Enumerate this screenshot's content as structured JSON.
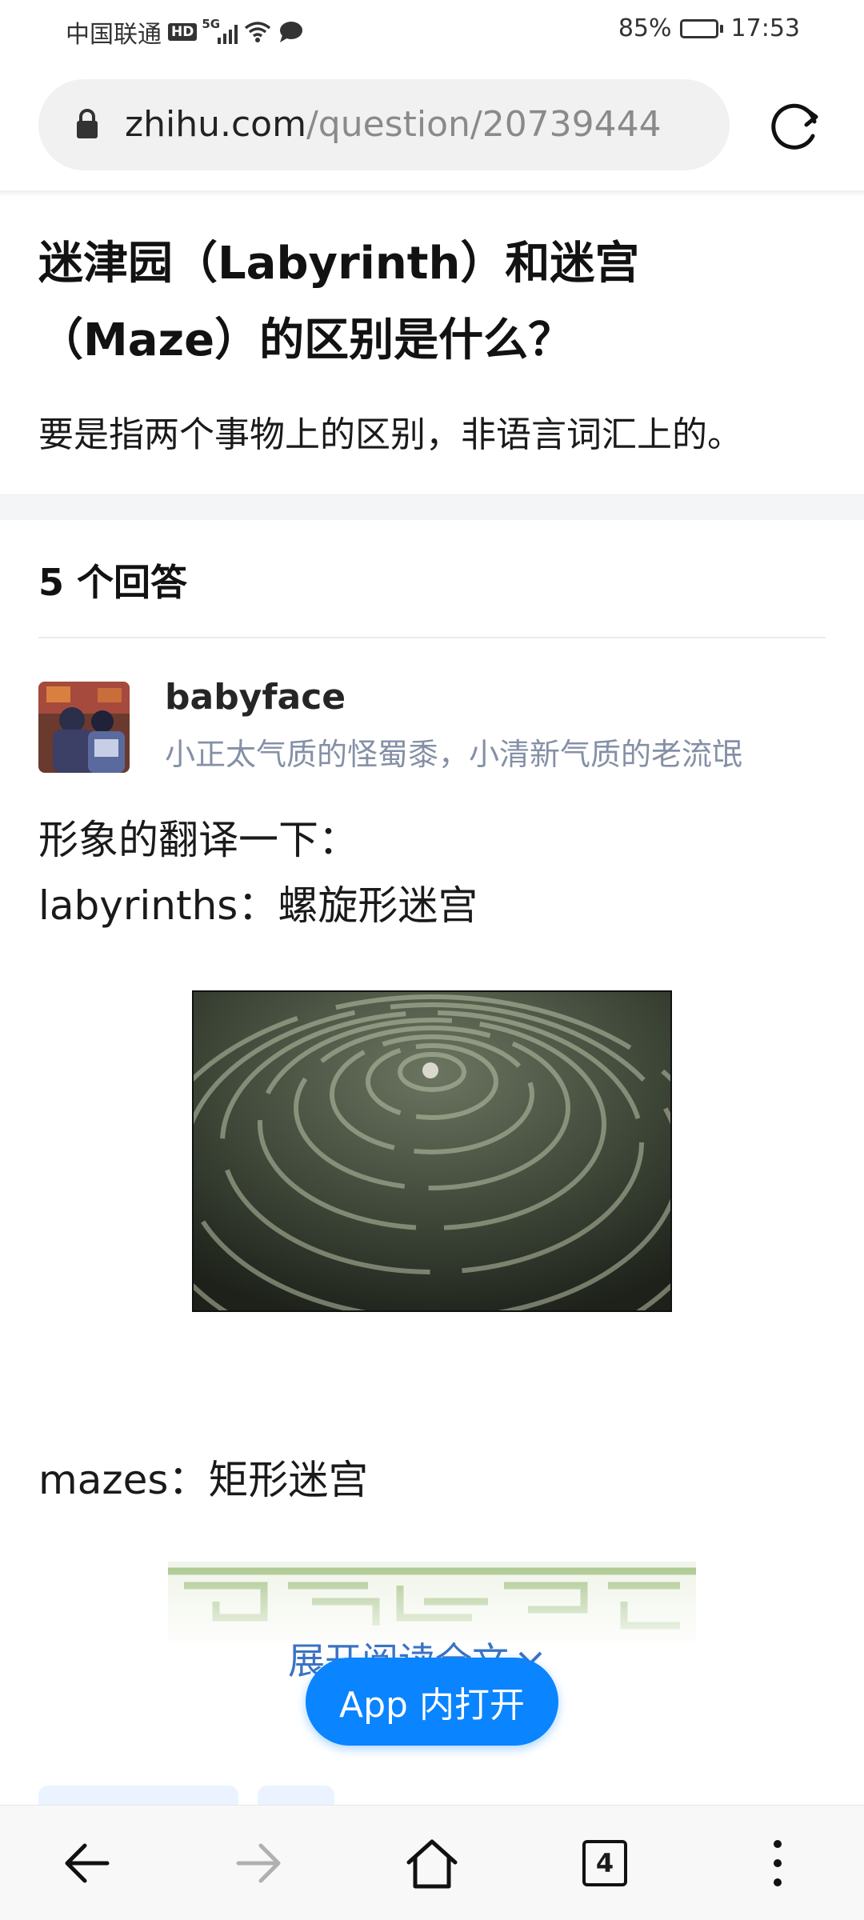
{
  "status_bar": {
    "carrier": "中国联通",
    "hd": "HD",
    "network": "5G",
    "battery": "85%",
    "battery_level": 0.85,
    "time": "17:53"
  },
  "browser": {
    "url_domain": "zhihu.com",
    "url_path": "/question/20739444"
  },
  "question": {
    "title": "迷津园（Labyrinth）和迷宫（Maze）的区别是什么？",
    "description": "要是指两个事物上的区别，非语言词汇上的。"
  },
  "answers": {
    "count_label": "5 个回答"
  },
  "answer": {
    "author_name": "babyface",
    "author_bio": "小正太气质的怪蜀黍，小清新气质的老流氓",
    "line1": "形象的翻译一下：",
    "line2": "labyrinths：螺旋形迷宫",
    "line3": "mazes：矩形迷宫"
  },
  "actions": {
    "expand_label": "展开阅读全文",
    "open_in_app_label": "App 内打开"
  },
  "bottom_nav": {
    "tab_count": "4"
  },
  "colors": {
    "accent": "#0a84ff",
    "link": "#3a73c4",
    "muted_text": "#8590a6"
  }
}
